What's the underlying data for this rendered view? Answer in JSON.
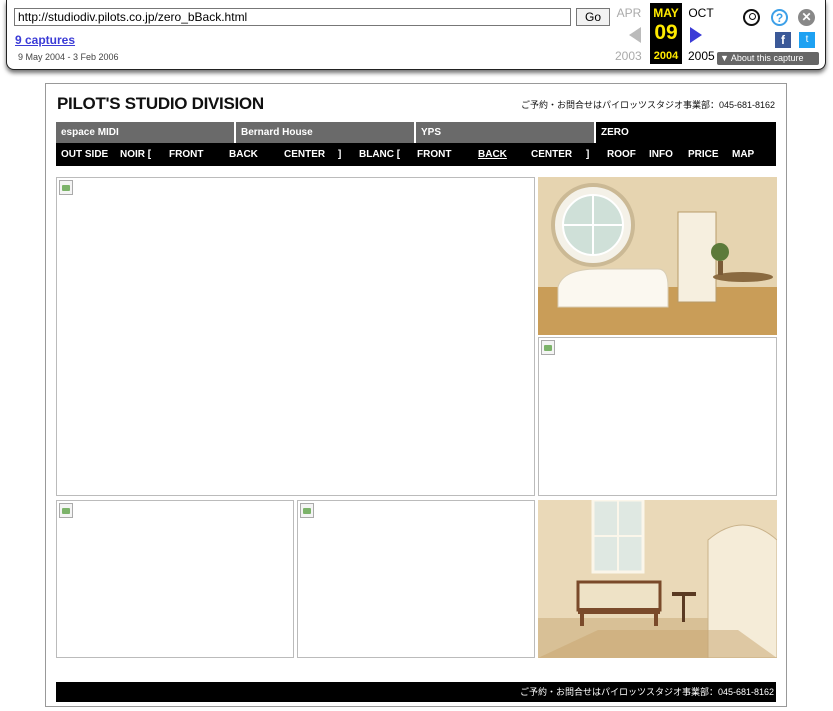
{
  "wayback": {
    "url": "http://studiodiv.pilots.co.jp/zero_bBack.html",
    "go_label": "Go",
    "captures_label": "9 captures",
    "date_range": "9 May 2004 - 3 Feb 2006",
    "prev_month": "APR",
    "current_month": "MAY",
    "current_day": "09",
    "current_year": "2004",
    "next_month": "OCT",
    "prev_year": "2003",
    "next_year": "2005",
    "about_label": "▼ About this capture",
    "help_glyph": "?",
    "close_glyph": "✕",
    "facebook_glyph": "f",
    "twitter_glyph": "t",
    "icons": [
      "user-icon",
      "help-icon",
      "close-icon",
      "facebook-icon",
      "twitter-icon",
      "prev-arrow-icon",
      "next-arrow-icon"
    ]
  },
  "site": {
    "title": "PILOT'S STUDIO DIVISION",
    "contact_top": "ご予約・お問合せはパイロッツスタジオ事業部：045-681-8162",
    "tabs": [
      "espace MIDI",
      "Bernard House",
      "YPS",
      "ZERO"
    ],
    "subnav": [
      "OUT SIDE",
      "NOIR [",
      "FRONT",
      "BACK",
      "CENTER",
      "]",
      "BLANC [",
      "FRONT",
      "BACK",
      "CENTER",
      "]",
      "ROOF",
      "INFO",
      "PRICE",
      "MAP"
    ],
    "active_subnav": "BACK",
    "footer": "ご予約・お問合せはパイロッツスタジオ事業部：045-681-8162"
  },
  "colors": {
    "tab_grey": "#6a6a6a",
    "nav_black": "#000000",
    "accent_yellow": "#ffea00",
    "link_blue": "#3b3bd6"
  }
}
